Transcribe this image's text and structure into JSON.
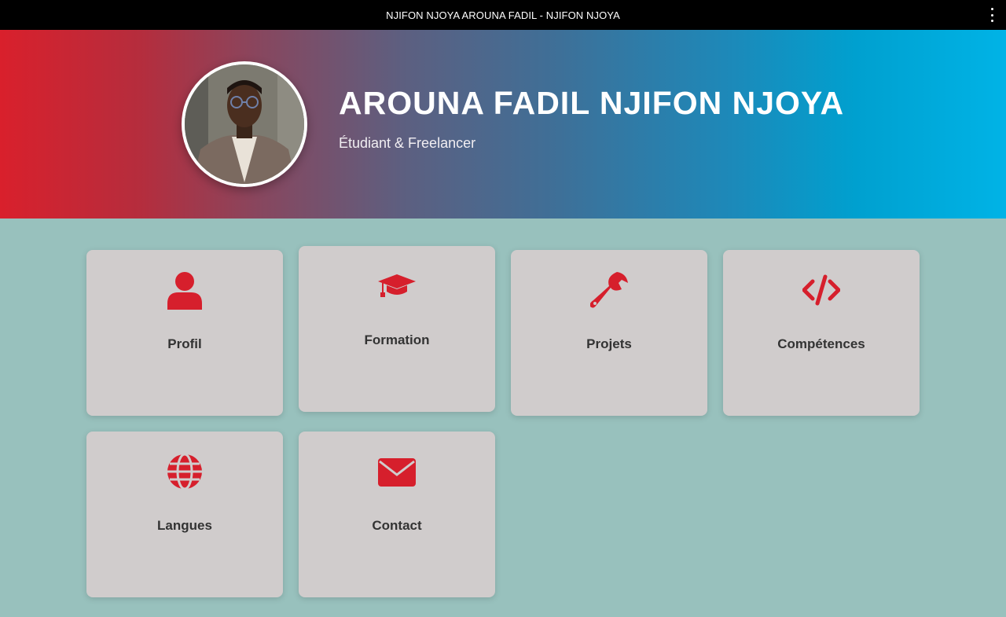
{
  "window": {
    "title": "NJIFON NJOYA AROUNA FADIL - NJIFON NJOYA"
  },
  "hero": {
    "name": "AROUNA FADIL NJIFON NJOYA",
    "subtitle": "Étudiant & Freelancer"
  },
  "accent_color": "#d61f2c",
  "cards": [
    {
      "label": "Profil",
      "icon": "user-icon"
    },
    {
      "label": "Formation",
      "icon": "graduation-cap-icon"
    },
    {
      "label": "Projets",
      "icon": "wrench-icon"
    },
    {
      "label": "Compétences",
      "icon": "code-icon"
    },
    {
      "label": "Langues",
      "icon": "globe-icon"
    },
    {
      "label": "Contact",
      "icon": "envelope-icon"
    }
  ]
}
